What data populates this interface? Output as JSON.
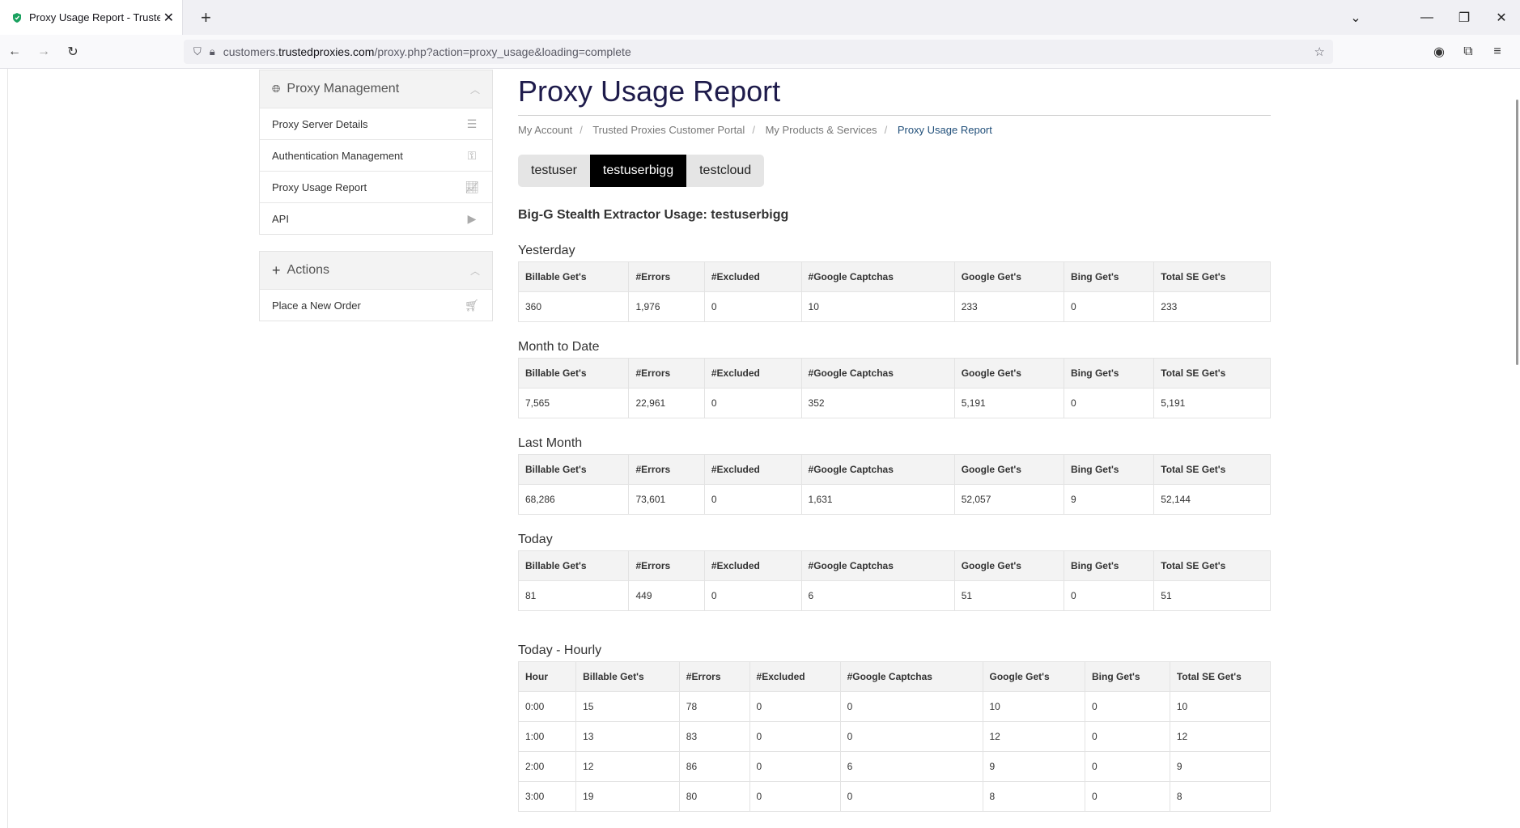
{
  "browser": {
    "tab_title": "Proxy Usage Report - Trusted Pr",
    "url_prefix": "customers.",
    "url_host": "trustedproxies.com",
    "url_path": "/proxy.php?action=proxy_usage&loading=complete"
  },
  "sidebar": {
    "proxy_management": {
      "title": "Proxy Management",
      "items": [
        {
          "label": "Proxy Server Details",
          "icon": "list-icon"
        },
        {
          "label": "Authentication Management",
          "icon": "key-icon"
        },
        {
          "label": "Proxy Usage Report",
          "icon": "chart-icon"
        },
        {
          "label": "API",
          "icon": "play-icon"
        }
      ]
    },
    "actions": {
      "title": "Actions",
      "items": [
        {
          "label": "Place a New Order",
          "icon": "cart-icon"
        }
      ]
    }
  },
  "main": {
    "title": "Proxy Usage Report",
    "breadcrumbs": [
      "My Account",
      "Trusted Proxies Customer Portal",
      "My Products & Services",
      "Proxy Usage Report"
    ],
    "user_tabs": [
      "testuser",
      "testuserbigg",
      "testcloud"
    ],
    "active_user_tab": "testuserbigg",
    "usage_heading": "Big-G Stealth Extractor Usage: testuserbigg",
    "columns": [
      "Billable Get's",
      "#Errors",
      "#Excluded",
      "#Google Captchas",
      "Google Get's",
      "Bing Get's",
      "Total SE Get's"
    ],
    "sections": [
      {
        "title": "Yesterday",
        "row": [
          "360",
          "1,976",
          "0",
          "10",
          "233",
          "0",
          "233"
        ]
      },
      {
        "title": "Month to Date",
        "row": [
          "7,565",
          "22,961",
          "0",
          "352",
          "5,191",
          "0",
          "5,191"
        ]
      },
      {
        "title": "Last Month",
        "row": [
          "68,286",
          "73,601",
          "0",
          "1,631",
          "52,057",
          "9",
          "52,144"
        ]
      },
      {
        "title": "Today",
        "row": [
          "81",
          "449",
          "0",
          "6",
          "51",
          "0",
          "51"
        ]
      }
    ],
    "hourly": {
      "title": "Today - Hourly",
      "columns": [
        "Hour",
        "Billable Get's",
        "#Errors",
        "#Excluded",
        "#Google Captchas",
        "Google Get's",
        "Bing Get's",
        "Total SE Get's"
      ],
      "rows": [
        [
          "0:00",
          "15",
          "78",
          "0",
          "0",
          "10",
          "0",
          "10"
        ],
        [
          "1:00",
          "13",
          "83",
          "0",
          "0",
          "12",
          "0",
          "12"
        ],
        [
          "2:00",
          "12",
          "86",
          "0",
          "6",
          "9",
          "0",
          "9"
        ],
        [
          "3:00",
          "19",
          "80",
          "0",
          "0",
          "8",
          "0",
          "8"
        ]
      ]
    }
  }
}
